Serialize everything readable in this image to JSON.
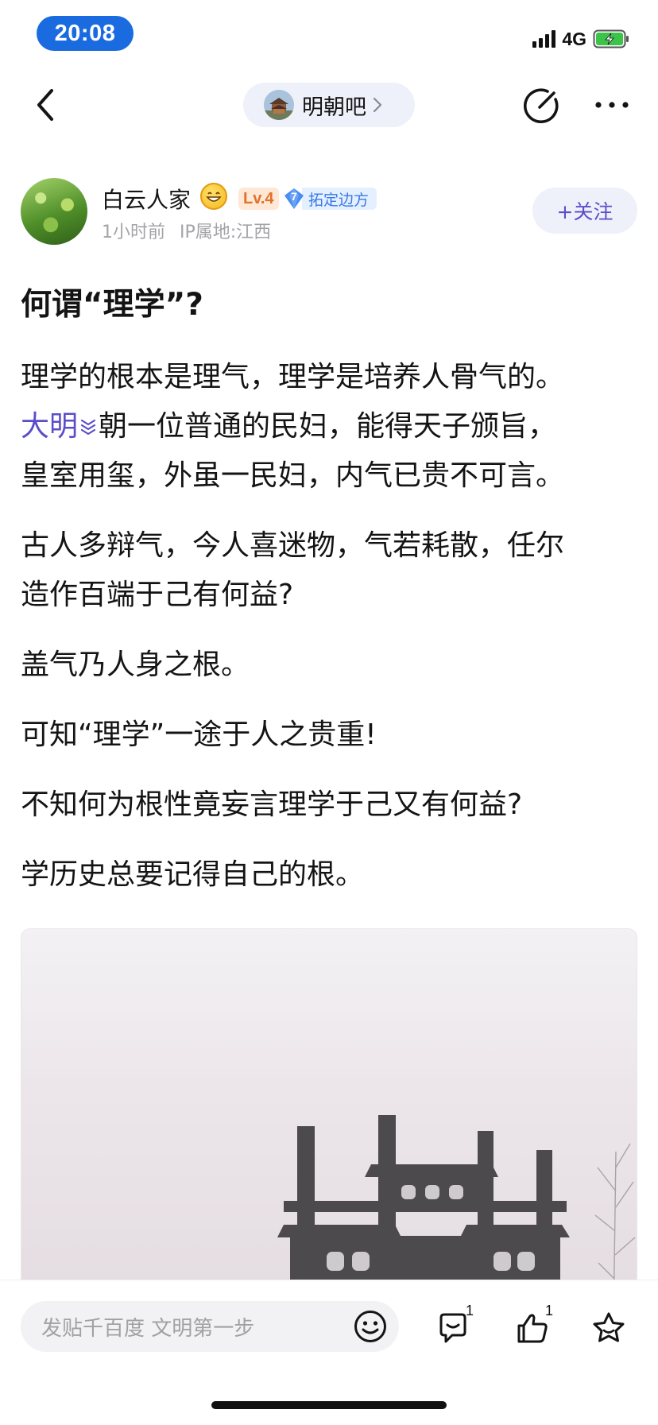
{
  "status_bar": {
    "time": "20:08",
    "network": "4G",
    "battery_color": "#3bc34a"
  },
  "nav": {
    "forum_name": "明朝吧",
    "back_icon": "chevron-left-icon",
    "edit_icon": "edit-icon",
    "more_icon": "more-horizontal-icon"
  },
  "author": {
    "name": "白云人家",
    "level": "Lv.4",
    "title_badge_number": "7",
    "title_badge_text": "拓定边方",
    "time_ago": "1小时前",
    "ip_location": "IP属地:江西",
    "follow_label": "+关注"
  },
  "post": {
    "title": "何谓“理学”?",
    "paragraphs": {
      "p1_line1": "理学的根本是理气，理学是培养人骨气的。",
      "p1_topic": "大明",
      "p1_line2_rest": "朝一位普通的民妇，能得天子颁旨，",
      "p1_line3": "皇室用玺，外虽一民妇，内气已贵不可言。",
      "p2_line1": "古人多辩气，今人喜迷物，气若耗散，任尔",
      "p2_line2": "造作百端于己有何益?",
      "p3": "盖气乃人身之根。",
      "p4": "可知“理学”一途于人之贵重!",
      "p5": "不知何为根性竟妄言理学于己又有何益?",
      "p6": "学历史总要记得自己的根。"
    }
  },
  "bottom_bar": {
    "reply_placeholder": "发贴千百度 文明第一步",
    "comment_count": "1",
    "like_count": "1"
  },
  "colors": {
    "accent": "#5a4ec8",
    "time_pill": "#1a6be0",
    "pill_background": "#eef0fa",
    "level_badge": "#e0722a",
    "title_badge": "#3a78e8"
  }
}
